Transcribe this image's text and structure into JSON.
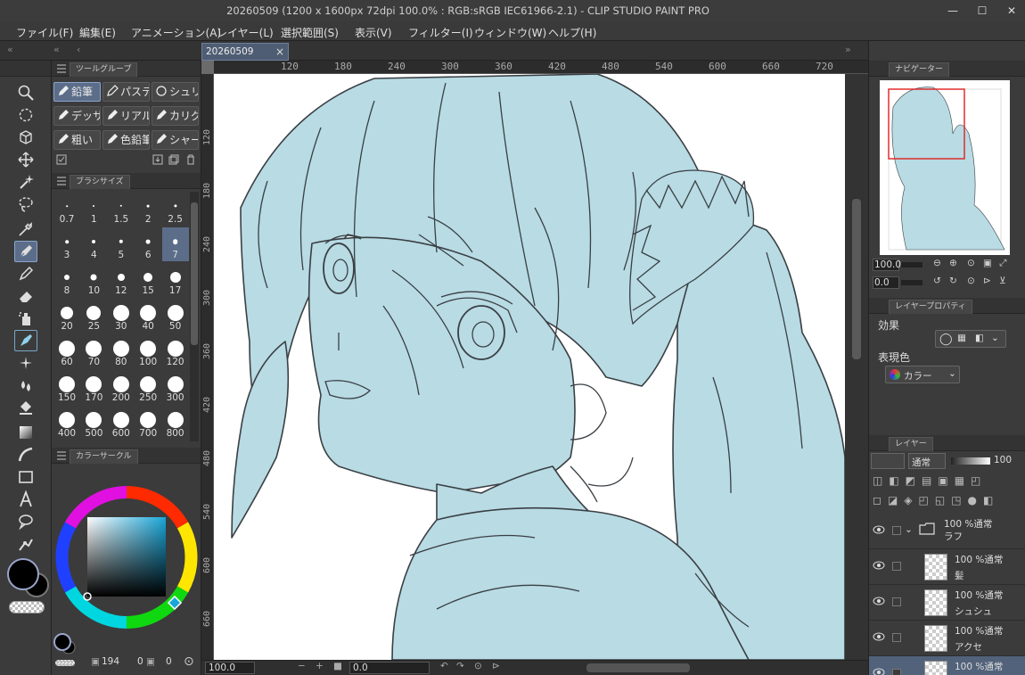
{
  "window": {
    "title": "20260509 (1200 x 1600px 72dpi 100.0% : RGB:sRGB IEC61966-2.1)  - CLIP STUDIO PAINT PRO",
    "minimize_glyph": "—",
    "maximize_glyph": "☐",
    "close_glyph": "✕"
  },
  "menu": [
    "ファイル(F)",
    "編集(E)",
    "アニメーション(A)",
    "レイヤー(L)",
    "選択範囲(S)",
    "表示(V)",
    "フィルター(I)",
    "ウィンドウ(W)",
    "ヘルプ(H)"
  ],
  "tabs": {
    "left_collapse": "«",
    "left_collapse2": "«",
    "back": "‹",
    "document_tab": "20260509",
    "close": "×",
    "right_collapse": "»",
    "right_collapse2": "»"
  },
  "sub_tool": {
    "panel_tab": "ツールグループ",
    "buttons": [
      "鉛筆",
      "パステル",
      "シュリンク",
      "デッサン",
      "リアル",
      "カリグラフィ",
      "粗い",
      "色鉛筆",
      "シャープ"
    ],
    "selected": "鉛筆"
  },
  "brush_size": {
    "panel_tab": "ブラシサイズ",
    "sizes": [
      "0.7",
      "1",
      "1.5",
      "2",
      "2.5",
      "3",
      "4",
      "5",
      "6",
      "7",
      "8",
      "10",
      "12",
      "15",
      "17",
      "20",
      "25",
      "30",
      "40",
      "50",
      "60",
      "70",
      "80",
      "100",
      "120",
      "150",
      "170",
      "200",
      "250",
      "300",
      "400",
      "500",
      "600",
      "700",
      "800"
    ],
    "selected": "7"
  },
  "color_circle": {
    "panel_tab": "カラーサークル",
    "hue_color": "#19a6d8",
    "main_color": "#000000",
    "sub_color": "#000000"
  },
  "bottom_left_status": {
    "value1": "194",
    "value2": "0",
    "value3": "0"
  },
  "ruler": {
    "h_ticks": [
      "120",
      "180",
      "240",
      "300",
      "360",
      "420",
      "480",
      "540",
      "600",
      "660",
      "720"
    ],
    "v_ticks": [
      "120",
      "180",
      "240",
      "300",
      "360",
      "420",
      "480",
      "540",
      "600",
      "660"
    ]
  },
  "canvas_status": {
    "zoom": "100.0",
    "rotation": "0.0"
  },
  "navigator": {
    "panel_tab": "ナビゲーター",
    "zoom": "100.0",
    "rotation": "0.0"
  },
  "layer_property": {
    "panel_tab": "レイヤープロパティ",
    "effect_label": "効果",
    "expression_label": "表現色",
    "expression_value": "カラー"
  },
  "layers": {
    "panel_tab": "レイヤー",
    "blend_mode": "通常",
    "opacity": "100",
    "items": [
      {
        "opacity": "100 %通常",
        "name": "ラフ",
        "type": "folder"
      },
      {
        "opacity": "100 %通常",
        "name": "髪",
        "type": "raster"
      },
      {
        "opacity": "100 %通常",
        "name": "シュシュ",
        "type": "raster"
      },
      {
        "opacity": "100 %通常",
        "name": "アクセ",
        "type": "raster"
      },
      {
        "opacity": "100 %通常",
        "name": "",
        "type": "raster"
      }
    ]
  },
  "colors": {
    "accent": "#5b6d89",
    "fill": "#b8dbe4",
    "line": "#3a3f43",
    "nav_box": "#e02020"
  }
}
